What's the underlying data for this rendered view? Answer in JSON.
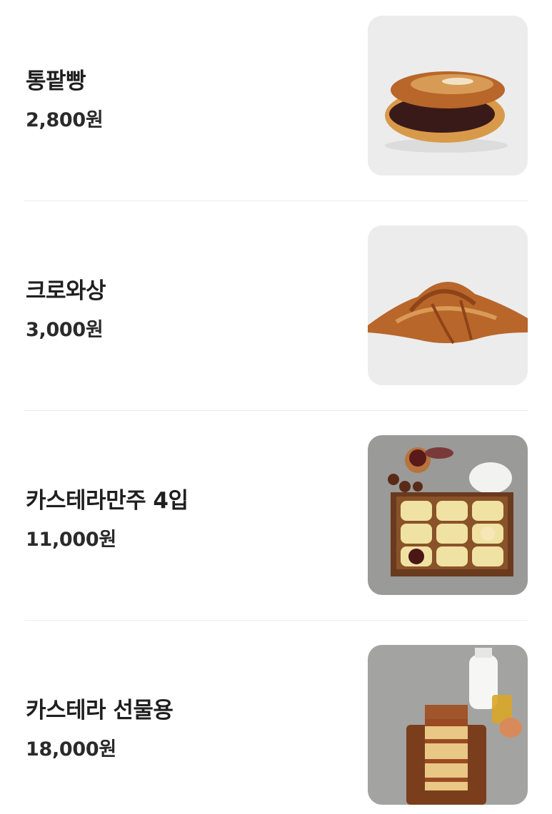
{
  "menu": {
    "items": [
      {
        "name": "통팥빵",
        "price": "2,800원",
        "image": "red-bean-bread-photo"
      },
      {
        "name": "크로와상",
        "price": "3,000원",
        "image": "croissant-photo"
      },
      {
        "name": "카스테라만주 4입",
        "price": "11,000원",
        "image": "castella-manju-box-photo"
      },
      {
        "name": "카스테라 선물용",
        "price": "18,000원",
        "image": "castella-gift-photo"
      }
    ]
  }
}
